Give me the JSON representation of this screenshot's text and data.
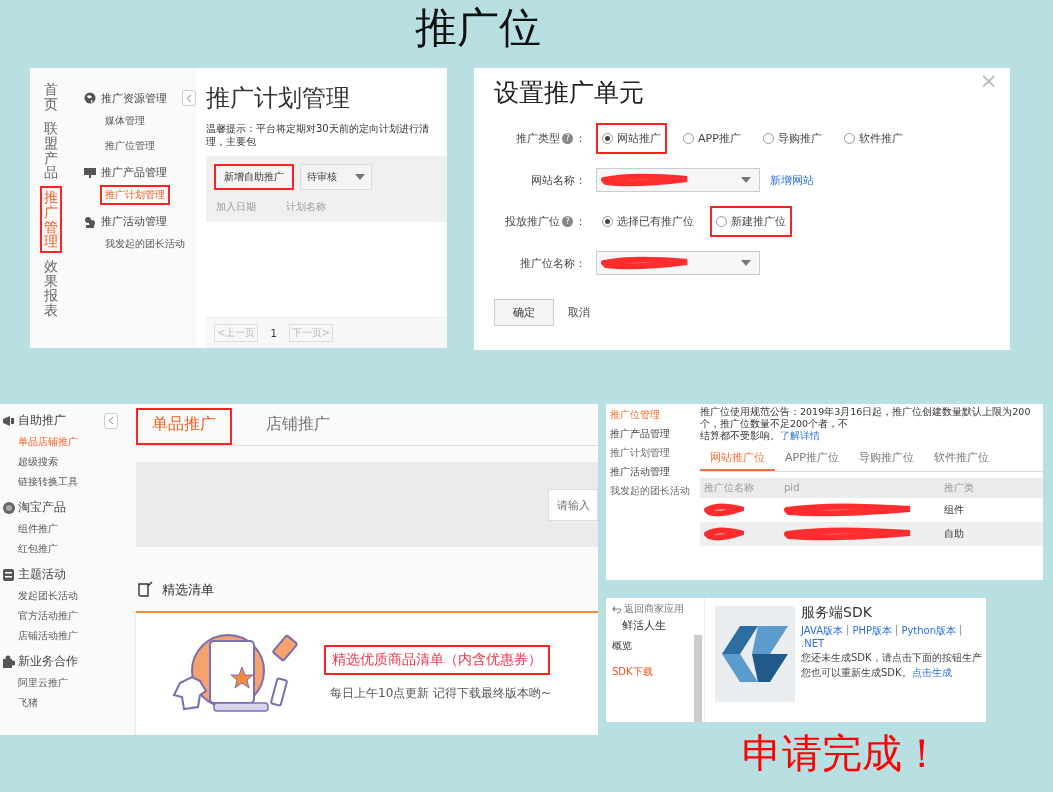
{
  "title": "推广位",
  "plan_panel": {
    "main_nav": [
      {
        "label": "首页",
        "selected": false,
        "highlighted": false
      },
      {
        "label": "联盟产品",
        "selected": false,
        "highlighted": false
      },
      {
        "label": "推广管理",
        "selected": true,
        "highlighted": true
      },
      {
        "label": "效果报表",
        "selected": false,
        "highlighted": false
      }
    ],
    "sub_nav": [
      {
        "title": "推广资源管理",
        "items": [
          {
            "label": "媒体管理",
            "selected": false,
            "highlighted": false
          },
          {
            "label": "推广位管理",
            "selected": false,
            "highlighted": false
          }
        ]
      },
      {
        "title": "推广产品管理",
        "items": [
          {
            "label": "推广计划管理",
            "selected": true,
            "highlighted": true
          }
        ]
      },
      {
        "title": "推广活动管理",
        "items": [
          {
            "label": "我发起的团长活动",
            "selected": false,
            "highlighted": false
          }
        ]
      }
    ],
    "heading": "推广计划管理",
    "notice": "温馨提示：平台将定期对30天前的定向计划进行清理，主要包",
    "add_button": {
      "label": "新增自助推广",
      "highlighted": true
    },
    "status_select": "待审核",
    "columns": [
      "加入日期",
      "计划名称"
    ],
    "pager": {
      "prev": "<上一页",
      "page": "1",
      "next": "下一页>"
    }
  },
  "unit_dialog": {
    "title": "设置推广单元",
    "close": "×",
    "rows": [
      {
        "kind": "radio",
        "label": "推广类型",
        "help": "?",
        "suffix": "：",
        "options": [
          {
            "label": "网站推广",
            "selected": true,
            "highlighted": true
          },
          {
            "label": "APP推广",
            "selected": false,
            "highlighted": false
          },
          {
            "label": "导购推广",
            "selected": false,
            "highlighted": false
          },
          {
            "label": "软件推广",
            "selected": false,
            "highlighted": false
          }
        ]
      },
      {
        "kind": "select",
        "label": "网站名称：",
        "redacted": true,
        "link": "新增网站"
      },
      {
        "kind": "radio",
        "label": "投放推广位",
        "help": "?",
        "suffix": "：",
        "options": [
          {
            "label": "选择已有推广位",
            "selected": true,
            "highlighted": false
          },
          {
            "label": "新建推广位",
            "selected": false,
            "highlighted": true
          }
        ]
      },
      {
        "kind": "select",
        "label": "推广位名称：",
        "redacted": true
      }
    ],
    "confirm": "确定",
    "cancel": "取消"
  },
  "product_panel": {
    "sidebar": [
      {
        "title": "自助推广",
        "items": [
          {
            "label": "单品店铺推广",
            "selected": true
          },
          {
            "label": "超级搜索",
            "selected": false
          },
          {
            "label": "链接转换工具",
            "selected": false
          }
        ]
      },
      {
        "title": "淘宝产品",
        "items": [
          {
            "label": "组件推广",
            "selected": false
          },
          {
            "label": "红包推广",
            "selected": false
          }
        ]
      },
      {
        "title": "主题活动",
        "items": [
          {
            "label": "发起团长活动",
            "selected": false
          },
          {
            "label": "官方活动推广",
            "selected": false
          },
          {
            "label": "店铺活动推广",
            "selected": false
          }
        ]
      },
      {
        "title": "新业务合作",
        "items": [
          {
            "label": "阿里云推广",
            "selected": false
          },
          {
            "label": "飞猪",
            "selected": false
          }
        ]
      }
    ],
    "tabs": [
      {
        "label": "单品推广",
        "selected": true,
        "highlighted": true
      },
      {
        "label": "店铺推广",
        "selected": false,
        "highlighted": false
      }
    ],
    "search": {
      "placeholder": "请输入"
    },
    "section": "精选清单",
    "card": {
      "title": "精选优质商品清单（内含优惠券）",
      "highlighted": true,
      "subtitle": "每日上午10点更新 记得下载最终版本哟~"
    }
  },
  "adzone_panel": {
    "sidebar": [
      {
        "label": "推广位管理",
        "kind": "item",
        "selected": true
      },
      {
        "label": "推广产品管理",
        "kind": "group",
        "selected": false
      },
      {
        "label": "推广计划管理",
        "kind": "item",
        "selected": false
      },
      {
        "label": "推广活动管理",
        "kind": "group",
        "selected": false
      },
      {
        "label": "我发起的团长活动",
        "kind": "item",
        "selected": false
      }
    ],
    "notice": "推广位使用规范公告：2019年3月16日起，推广位创建数量默认上限为200个，推广位数量不足200个者，不",
    "notice_2": "结算都不受影响。",
    "notice_link": "了解详情",
    "tabs": [
      {
        "label": "网站推广位",
        "selected": true
      },
      {
        "label": "APP推广位",
        "selected": false
      },
      {
        "label": "导购推广位",
        "selected": false
      },
      {
        "label": "软件推广位",
        "selected": false
      }
    ],
    "columns": [
      "推广位名称",
      "pid",
      "推广类"
    ],
    "rows": [
      {
        "cells": [
          {
            "redacted": true
          },
          {
            "redacted": true
          },
          {
            "text": "组件"
          }
        ]
      },
      {
        "cells": [
          {
            "redacted": true
          },
          {
            "redacted": true
          },
          {
            "text": "自助"
          }
        ]
      }
    ]
  },
  "sdk_panel": {
    "back": "返回商家应用",
    "app_name": "鲜活人生",
    "nav": [
      {
        "label": "概览",
        "selected": false
      },
      {
        "label": "SDK下载",
        "selected": true
      }
    ],
    "title": "服务端SDK",
    "links": [
      {
        "label": "JAVA版本",
        "separator": "|"
      },
      {
        "label": "PHP版本",
        "separator": "|"
      },
      {
        "label": "Python版本",
        "separator": "|"
      },
      {
        "label": ".NET"
      }
    ],
    "text": "您还未生成SDK，请点击下面的按钮生产",
    "text_2": "您也可以重新生成SDK。",
    "link": "点击生成"
  },
  "footer": "申请完成！"
}
